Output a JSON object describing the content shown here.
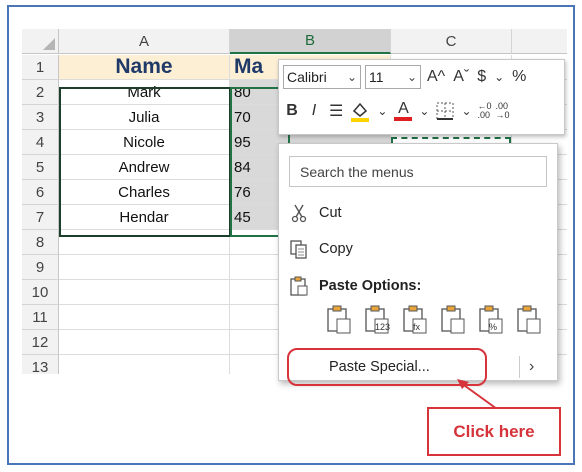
{
  "columns": [
    "A",
    "B",
    "C"
  ],
  "rows": [
    "1",
    "2",
    "3",
    "4",
    "5",
    "6",
    "7",
    "8",
    "9",
    "10",
    "11",
    "12",
    "13"
  ],
  "header_row": {
    "name": "Name",
    "marks_partial": "Ma"
  },
  "data_rows": [
    {
      "name": "Mark",
      "marks": "80"
    },
    {
      "name": "Julia",
      "marks": "70"
    },
    {
      "name": "Nicole",
      "marks": "95"
    },
    {
      "name": "Andrew",
      "marks": "84"
    },
    {
      "name": "Charles",
      "marks": "76"
    },
    {
      "name": "Hendar",
      "marks": "45"
    }
  ],
  "mini_toolbar": {
    "font_name": "Calibri",
    "font_size": "11",
    "grow_font": "A^",
    "shrink_font": "Aˇ",
    "currency": "$",
    "percent": "%",
    "bold": "B",
    "italic": "I",
    "font_color_letter": "A",
    "decrease_decimal_top": "←0",
    "decrease_decimal_bottom": ".00",
    "increase_decimal_top": ".00",
    "increase_decimal_bottom": "→0"
  },
  "context_menu": {
    "search_placeholder": "Search the menus",
    "cut": "Cut",
    "copy": "Copy",
    "paste_options": "Paste Options:",
    "paste_special": "Paste Special...",
    "paste_icon_labels": [
      "",
      "123",
      "fx",
      "",
      "%",
      ""
    ]
  },
  "callout": {
    "text": "Click here"
  },
  "colors": {
    "accent_red": "#d6333a",
    "excel_green": "#217346",
    "header_fill": "#fdefd4",
    "frame_blue": "#4a76b8"
  }
}
